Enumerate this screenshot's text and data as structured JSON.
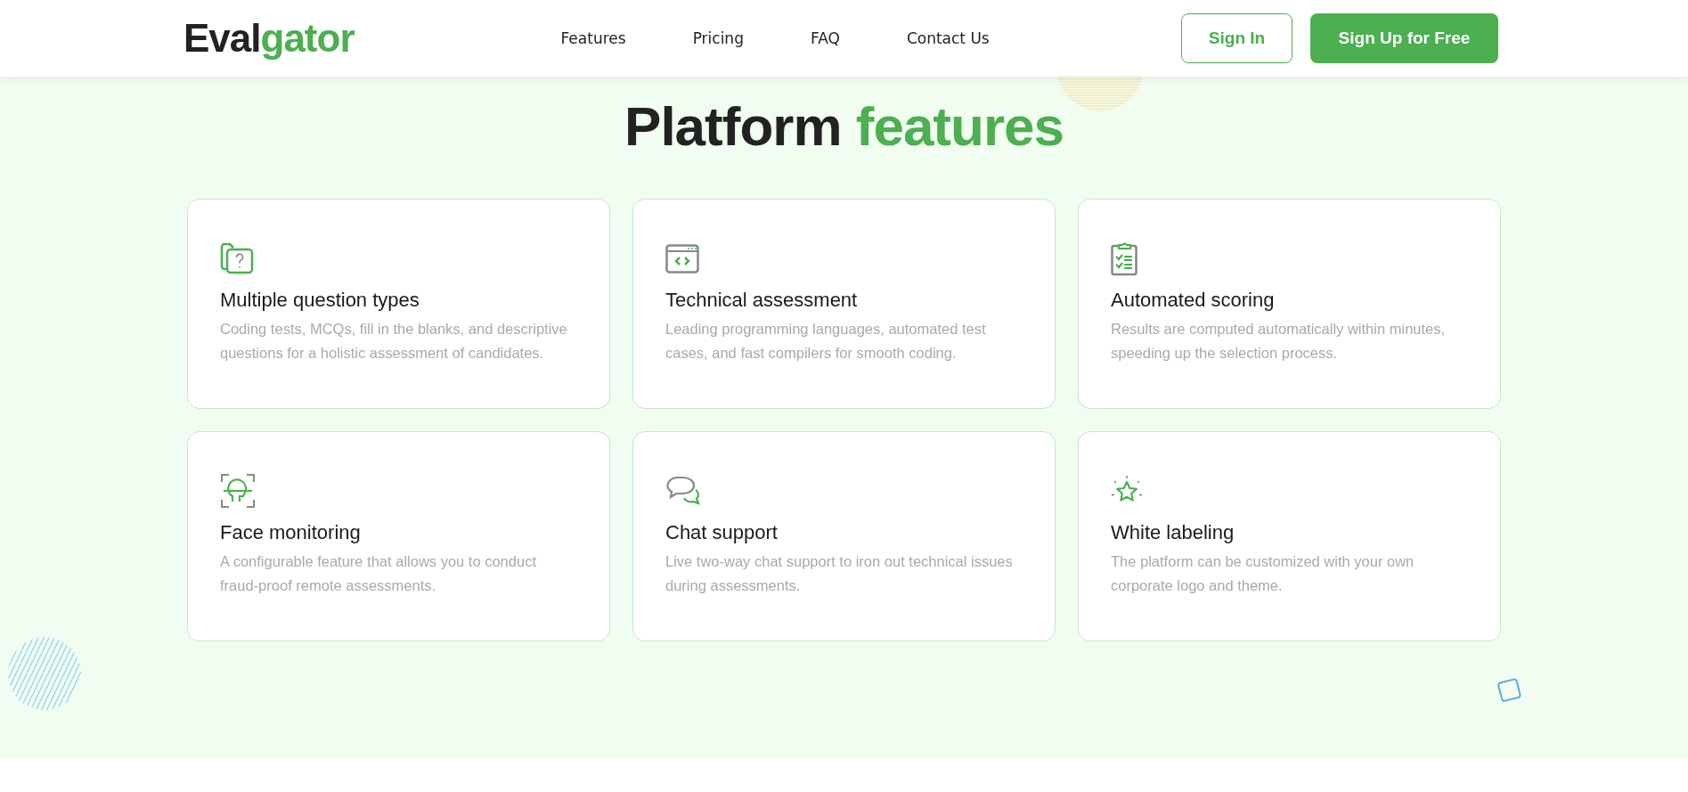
{
  "header": {
    "logo": {
      "dark": "Eval",
      "green": "gator"
    },
    "nav": [
      {
        "label": "Features"
      },
      {
        "label": "Pricing"
      },
      {
        "label": "FAQ"
      },
      {
        "label": "Contact Us"
      }
    ],
    "buttons": [
      {
        "label": "Sign In",
        "kind": "outline"
      },
      {
        "label": "Sign Up for Free",
        "kind": "solid"
      }
    ]
  },
  "section": {
    "title": "Platform",
    "title_highlight": "features",
    "cards": [
      {
        "kind": "folder",
        "title": "Multiple question types",
        "text": "Coding tests, MCQs, fill in the blanks, and descriptive questions for a holistic assessment of candidates."
      },
      {
        "kind": "code",
        "title": "Technical assessment",
        "text": "Leading programming languages, automated test cases, and fast compilers for smooth coding."
      },
      {
        "kind": "scoring",
        "title": "Automated scoring",
        "text": "Results are computed automatically within minutes, speeding up the selection process."
      },
      {
        "kind": "face",
        "title": "Face monitoring",
        "text": "A configurable feature that allows you to conduct fraud-proof remote assessments."
      },
      {
        "kind": "chat",
        "title": "Chat support",
        "text": "Live two-way chat support to iron out technical issues during assessments."
      },
      {
        "kind": "star",
        "title": "White labeling",
        "text": "The platform can be customized with your own corporate logo and theme."
      }
    ]
  }
}
